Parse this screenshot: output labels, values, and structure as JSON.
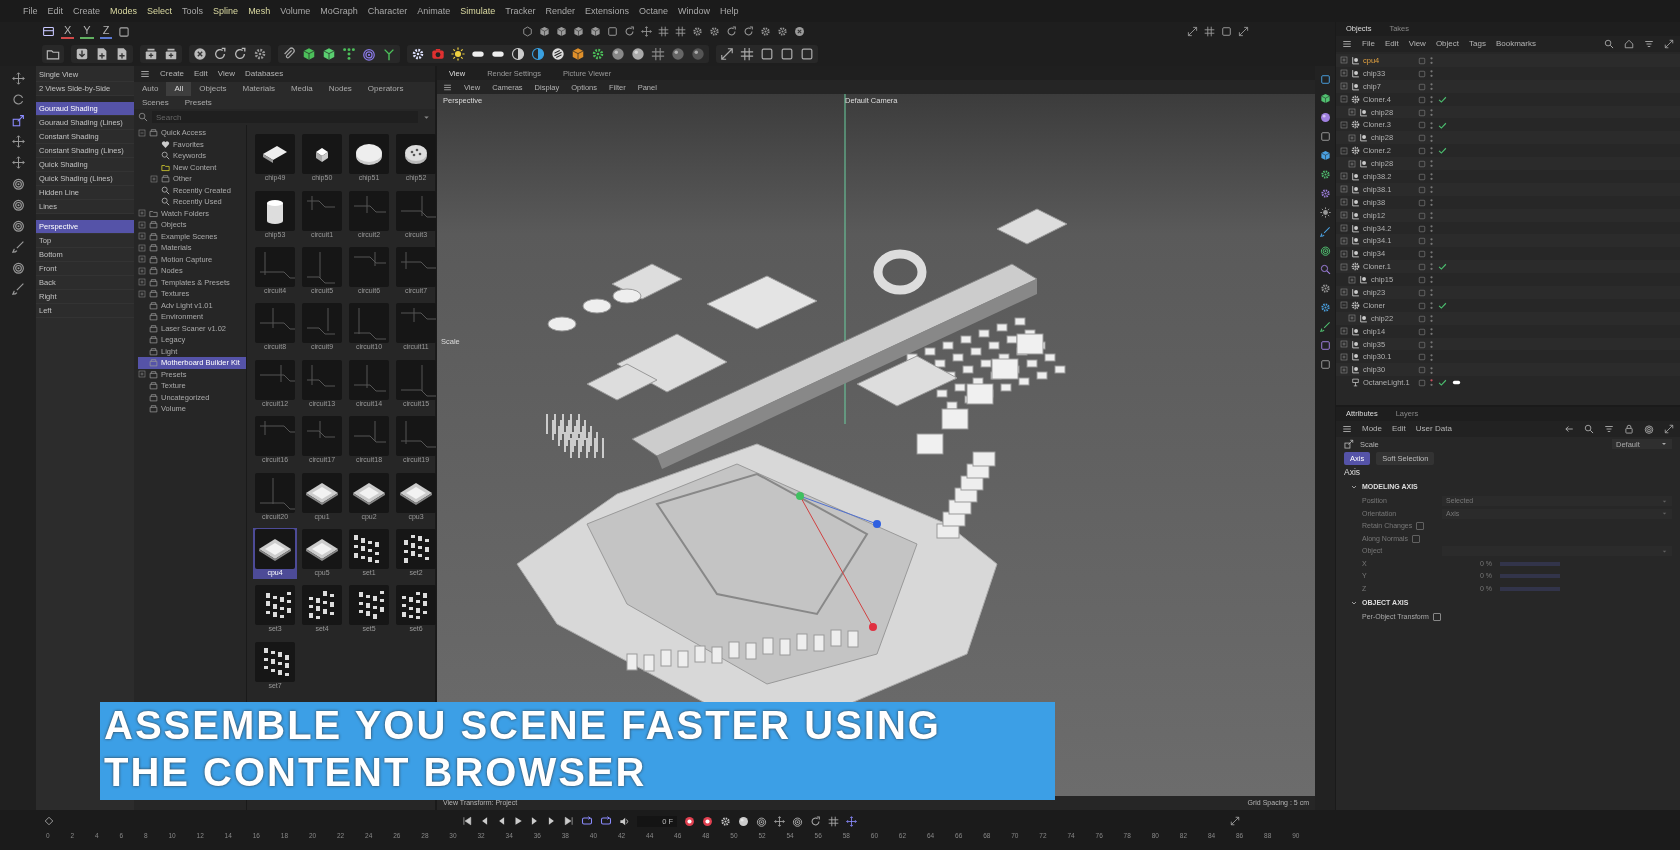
{
  "menu_bar": [
    {
      "label": "File",
      "highlighted": false
    },
    {
      "label": "Edit",
      "highlighted": false
    },
    {
      "label": "Create",
      "highlighted": false
    },
    {
      "label": "Modes",
      "highlighted": true
    },
    {
      "label": "Select",
      "highlighted": true
    },
    {
      "label": "Tools",
      "highlighted": false
    },
    {
      "label": "Spline",
      "highlighted": true
    },
    {
      "label": "Mesh",
      "highlighted": true
    },
    {
      "label": "Volume",
      "highlighted": false
    },
    {
      "label": "MoGraph",
      "highlighted": false
    },
    {
      "label": "Character",
      "highlighted": false
    },
    {
      "label": "Animate",
      "highlighted": false
    },
    {
      "label": "Simulate",
      "highlighted": true
    },
    {
      "label": "Tracker",
      "highlighted": false
    },
    {
      "label": "Render",
      "highlighted": false
    },
    {
      "label": "Extensions",
      "highlighted": false
    },
    {
      "label": "Octane",
      "highlighted": false
    },
    {
      "label": "Window",
      "highlighted": false
    },
    {
      "label": "Help",
      "highlighted": false
    }
  ],
  "toolbar": {
    "axis_toggles": [
      "X",
      "Y",
      "Z"
    ]
  },
  "view_menu": {
    "layouts": [
      "Single View",
      "2 Views Side-by-Side"
    ],
    "shading": [
      {
        "label": "Gouraud Shading",
        "selected": true
      },
      {
        "label": "Gouraud Shading (Lines)",
        "selected": false
      },
      {
        "label": "Constant Shading",
        "selected": false
      },
      {
        "label": "Constant Shading (Lines)",
        "selected": false
      },
      {
        "label": "Quick Shading",
        "selected": false
      },
      {
        "label": "Quick Shading (Lines)",
        "selected": false
      },
      {
        "label": "Hidden Line",
        "selected": false
      },
      {
        "label": "Lines",
        "selected": false
      }
    ],
    "cameras": [
      {
        "label": "Perspective",
        "selected": true
      },
      {
        "label": "Top",
        "selected": false
      },
      {
        "label": "Bottom",
        "selected": false
      },
      {
        "label": "Front",
        "selected": false
      },
      {
        "label": "Back",
        "selected": false
      },
      {
        "label": "Right",
        "selected": false
      },
      {
        "label": "Left",
        "selected": false
      }
    ]
  },
  "content_browser": {
    "menu": [
      "Create",
      "Edit",
      "View",
      "Databases"
    ],
    "tabs": [
      {
        "label": "Auto",
        "selected": false
      },
      {
        "label": "All",
        "selected": true
      },
      {
        "label": "Objects",
        "selected": false
      },
      {
        "label": "Materials",
        "selected": false
      },
      {
        "label": "Media",
        "selected": false
      },
      {
        "label": "Nodes",
        "selected": false
      },
      {
        "label": "Operators",
        "selected": false
      },
      {
        "label": "Scenes",
        "selected": false
      },
      {
        "label": "Presets",
        "selected": false
      }
    ],
    "search": {
      "placeholder": "Search"
    },
    "tree": [
      {
        "label": "Quick Access",
        "kind": "library",
        "selected": false,
        "expanded": true,
        "children": [
          {
            "label": "Favorites",
            "kind": "favorites",
            "selected": false
          },
          {
            "label": "Keywords",
            "kind": "search",
            "selected": false
          },
          {
            "label": "New Content",
            "kind": "new",
            "selected": false
          },
          {
            "label": "Other",
            "kind": "library",
            "selected": false,
            "expanded": false
          },
          {
            "label": "Recently Created",
            "kind": "search",
            "selected": false
          },
          {
            "label": "Recently Used",
            "kind": "search",
            "selected": false
          }
        ]
      },
      {
        "label": "Watch Folders",
        "kind": "folder",
        "selected": false,
        "expanded": false
      },
      {
        "label": "Objects",
        "kind": "library",
        "selected": false,
        "expanded": false
      },
      {
        "label": "Example Scenes",
        "kind": "library",
        "selected": false,
        "expanded": false
      },
      {
        "label": "Materials",
        "kind": "library",
        "selected": false,
        "expanded": false
      },
      {
        "label": "Motion Capture",
        "kind": "library",
        "selected": false,
        "expanded": false
      },
      {
        "label": "Nodes",
        "kind": "library",
        "selected": false,
        "expanded": false
      },
      {
        "label": "Templates & Presets",
        "kind": "library",
        "selected": false,
        "expanded": false
      },
      {
        "label": "Textures",
        "kind": "library",
        "selected": false,
        "expanded": false
      },
      {
        "label": "Adv Light v1.01",
        "kind": "library",
        "selected": false
      },
      {
        "label": "Environment",
        "kind": "library",
        "selected": false
      },
      {
        "label": "Laser Scaner v1.02",
        "kind": "library",
        "selected": false
      },
      {
        "label": "Legacy",
        "kind": "library",
        "selected": false
      },
      {
        "label": "Light",
        "kind": "library",
        "selected": false
      },
      {
        "label": "Motherboard Builder Kit",
        "kind": "library",
        "selected": true
      },
      {
        "label": "Presets",
        "kind": "library",
        "selected": false,
        "expanded": false
      },
      {
        "label": "Texture",
        "kind": "library",
        "selected": false
      },
      {
        "label": "Uncategorized",
        "kind": "library",
        "selected": false
      },
      {
        "label": "Volume",
        "kind": "library",
        "selected": false
      }
    ],
    "assets": [
      {
        "label": "chip49",
        "kind": "chip",
        "selected": false
      },
      {
        "label": "chip50",
        "kind": "chip",
        "selected": false
      },
      {
        "label": "chip51",
        "kind": "chip",
        "selected": false
      },
      {
        "label": "chip52",
        "kind": "chip",
        "selected": false
      },
      {
        "label": "chip53",
        "kind": "chip",
        "selected": false
      },
      {
        "label": "circuit1",
        "kind": "circuit",
        "selected": false
      },
      {
        "label": "circuit2",
        "kind": "circuit",
        "selected": false
      },
      {
        "label": "circuit3",
        "kind": "circuit",
        "selected": false
      },
      {
        "label": "circuit4",
        "kind": "circuit",
        "selected": false
      },
      {
        "label": "circuit5",
        "kind": "circuit",
        "selected": false
      },
      {
        "label": "circuit6",
        "kind": "circuit",
        "selected": false
      },
      {
        "label": "circuit7",
        "kind": "circuit",
        "selected": false
      },
      {
        "label": "circuit8",
        "kind": "circuit",
        "selected": false
      },
      {
        "label": "circuit9",
        "kind": "circuit",
        "selected": false
      },
      {
        "label": "circuit10",
        "kind": "circuit",
        "selected": false
      },
      {
        "label": "circuit11",
        "kind": "circuit",
        "selected": false
      },
      {
        "label": "circuit12",
        "kind": "circuit",
        "selected": false
      },
      {
        "label": "circuit13",
        "kind": "circuit",
        "selected": false
      },
      {
        "label": "circuit14",
        "kind": "circuit",
        "selected": false
      },
      {
        "label": "circuit15",
        "kind": "circuit",
        "selected": false
      },
      {
        "label": "circuit16",
        "kind": "circuit",
        "selected": false
      },
      {
        "label": "circuit17",
        "kind": "circuit",
        "selected": false
      },
      {
        "label": "circuit18",
        "kind": "circuit",
        "selected": false
      },
      {
        "label": "circuit19",
        "kind": "circuit",
        "selected": false
      },
      {
        "label": "circuit20",
        "kind": "circuit",
        "selected": false
      },
      {
        "label": "cpu1",
        "kind": "cpu",
        "selected": false
      },
      {
        "label": "cpu2",
        "kind": "cpu",
        "selected": false
      },
      {
        "label": "cpu3",
        "kind": "cpu",
        "selected": false
      },
      {
        "label": "cpu4",
        "kind": "cpu",
        "selected": true
      },
      {
        "label": "cpu5",
        "kind": "cpu",
        "selected": false
      },
      {
        "label": "set1",
        "kind": "set",
        "selected": false
      },
      {
        "label": "set2",
        "kind": "set",
        "selected": false
      },
      {
        "label": "set3",
        "kind": "set",
        "selected": false
      },
      {
        "label": "set4",
        "kind": "set",
        "selected": false
      },
      {
        "label": "set5",
        "kind": "set",
        "selected": false
      },
      {
        "label": "set6",
        "kind": "set",
        "selected": false
      },
      {
        "label": "set7",
        "kind": "set",
        "selected": false
      }
    ]
  },
  "viewport": {
    "tabs": [
      {
        "label": "View",
        "selected": true
      },
      {
        "label": "Render Settings",
        "selected": false
      },
      {
        "label": "Picture Viewer",
        "selected": false
      }
    ],
    "menu": [
      "View",
      "Cameras",
      "Display",
      "Options",
      "Filter",
      "Panel"
    ],
    "camera_label": "Perspective",
    "default_camera": "Default Camera",
    "tool_label": "Scale",
    "view_transform": "View Transform: Project",
    "grid_spacing": "Grid Spacing : 5 cm"
  },
  "objects_panel": {
    "tabs": [
      {
        "label": "Objects",
        "selected": true
      },
      {
        "label": "Takes",
        "selected": false
      }
    ],
    "menu": [
      "File",
      "Edit",
      "View",
      "Object",
      "Tags",
      "Bookmarks"
    ],
    "objects": [
      {
        "name": "cpu4",
        "kind": "null",
        "selected": true,
        "checked": false,
        "expanded": false
      },
      {
        "name": "chip33",
        "kind": "null",
        "selected": false,
        "checked": false,
        "expanded": false
      },
      {
        "name": "chip7",
        "kind": "null",
        "selected": false,
        "checked": false,
        "expanded": false
      },
      {
        "name": "Cloner.4",
        "kind": "cloner",
        "selected": false,
        "checked": true,
        "expanded": true,
        "children": [
          {
            "name": "chip28",
            "kind": "null",
            "selected": false,
            "checked": false,
            "expanded": false
          }
        ]
      },
      {
        "name": "Cloner.3",
        "kind": "cloner",
        "selected": false,
        "checked": true,
        "expanded": true,
        "children": [
          {
            "name": "chip28",
            "kind": "null",
            "selected": false,
            "checked": false,
            "expanded": false
          }
        ]
      },
      {
        "name": "Cloner.2",
        "kind": "cloner",
        "selected": false,
        "checked": true,
        "expanded": true,
        "children": [
          {
            "name": "chip28",
            "kind": "null",
            "selected": false,
            "checked": false,
            "expanded": false
          }
        ]
      },
      {
        "name": "chip38.2",
        "kind": "null",
        "selected": false,
        "checked": false,
        "expanded": false
      },
      {
        "name": "chip38.1",
        "kind": "null",
        "selected": false,
        "checked": false,
        "expanded": false
      },
      {
        "name": "chip38",
        "kind": "null",
        "selected": false,
        "checked": false,
        "expanded": false
      },
      {
        "name": "chip12",
        "kind": "null",
        "selected": false,
        "checked": false,
        "expanded": false
      },
      {
        "name": "chip34.2",
        "kind": "null",
        "selected": false,
        "checked": false,
        "expanded": false
      },
      {
        "name": "chip34.1",
        "kind": "null",
        "selected": false,
        "checked": false,
        "expanded": false
      },
      {
        "name": "chip34",
        "kind": "null",
        "selected": false,
        "checked": false,
        "expanded": false
      },
      {
        "name": "Cloner.1",
        "kind": "cloner",
        "selected": false,
        "checked": true,
        "expanded": true,
        "children": [
          {
            "name": "chip15",
            "kind": "null",
            "selected": false,
            "checked": false,
            "expanded": false
          }
        ]
      },
      {
        "name": "chip23",
        "kind": "null",
        "selected": false,
        "checked": false,
        "expanded": false
      },
      {
        "name": "Cloner",
        "kind": "cloner",
        "selected": false,
        "checked": true,
        "expanded": true,
        "children": [
          {
            "name": "chip22",
            "kind": "null",
            "selected": false,
            "checked": false,
            "expanded": false
          }
        ]
      },
      {
        "name": "chip14",
        "kind": "null",
        "selected": false,
        "checked": false,
        "expanded": false
      },
      {
        "name": "chip35",
        "kind": "null",
        "selected": false,
        "checked": false,
        "expanded": false
      },
      {
        "name": "chip30.1",
        "kind": "null",
        "selected": false,
        "checked": false,
        "expanded": false
      },
      {
        "name": "chip30",
        "kind": "null",
        "selected": false,
        "checked": false,
        "expanded": false
      },
      {
        "name": "OctaneLight.1",
        "kind": "light",
        "selected": false,
        "checked": true
      }
    ]
  },
  "attributes_panel": {
    "tabs": [
      {
        "label": "Attributes",
        "selected": true
      },
      {
        "label": "Layers",
        "selected": false
      }
    ],
    "menu": [
      "Mode",
      "Edit",
      "User Data"
    ],
    "object_name": "Scale",
    "preset": "Default",
    "subtabs": [
      {
        "label": "Axis",
        "selected": true
      },
      {
        "label": "Soft Selection",
        "selected": false
      }
    ],
    "heading": "Axis",
    "sections": [
      {
        "title": "MODELING AXIS",
        "fields": [
          {
            "kind": "dropdown",
            "label": "Position",
            "value": "Selected",
            "disabled": true
          },
          {
            "kind": "dropdown",
            "label": "Orientation",
            "value": "Axis",
            "disabled": true
          },
          {
            "kind": "checkbox",
            "label": "Retain Changes",
            "checked": false,
            "disabled": true
          },
          {
            "kind": "checkbox",
            "label": "Along Normals",
            "checked": false,
            "disabled": true
          },
          {
            "kind": "dropdown",
            "label": "Object",
            "disabled": true
          },
          {
            "kind": "slider",
            "label": "X",
            "value": "0 %",
            "level": 0,
            "disabled": true
          },
          {
            "kind": "slider",
            "label": "Y",
            "value": "0 %",
            "level": 0,
            "disabled": true
          },
          {
            "kind": "slider",
            "label": "Z",
            "value": "0 %",
            "level": 0,
            "disabled": true
          }
        ]
      },
      {
        "title": "OBJECT AXIS",
        "fields": [
          {
            "kind": "checkbox",
            "label": "Per-Object Transform",
            "checked": false,
            "disabled": false
          }
        ]
      }
    ]
  },
  "timeline": {
    "frame": "0 F",
    "ticks": [
      "0",
      "2",
      "4",
      "6",
      "8",
      "10",
      "12",
      "14",
      "16",
      "18",
      "20",
      "22",
      "24",
      "26",
      "28",
      "30",
      "32",
      "34",
      "36",
      "38",
      "40",
      "42",
      "44",
      "46",
      "48",
      "50",
      "52",
      "54",
      "56",
      "58",
      "60",
      "62",
      "64",
      "66",
      "68",
      "70",
      "72",
      "74",
      "76",
      "78",
      "80",
      "82",
      "84",
      "86",
      "88",
      "90"
    ]
  },
  "caption": [
    "ASSEMBLE YOU SCENE FASTER USING",
    "THE CONTENT BROWSER"
  ]
}
